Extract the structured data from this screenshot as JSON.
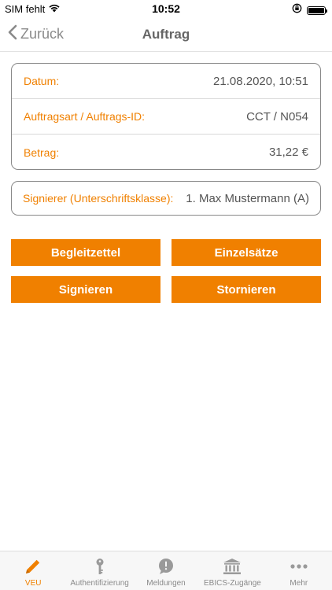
{
  "status_bar": {
    "carrier": "SIM fehlt",
    "time": "10:52"
  },
  "nav": {
    "back_label": "Zurück",
    "title": "Auftrag"
  },
  "details": {
    "rows": [
      {
        "label": "Datum:",
        "value": "21.08.2020, 10:51"
      },
      {
        "label": "Auftragsart / Auftrags-ID:",
        "value": "CCT / N054"
      },
      {
        "label": "Betrag:",
        "value": "31,22 €"
      }
    ]
  },
  "signer": {
    "label": "Signierer (Unterschriftsklasse):",
    "value": "1. Max Mustermann (A)"
  },
  "actions": {
    "begleitzettel": "Begleitzettel",
    "einzelsaetze": "Einzelsätze",
    "signieren": "Signieren",
    "stornieren": "Stornieren"
  },
  "tabs": [
    {
      "label": "VEU",
      "icon": "pencil-icon",
      "active": true
    },
    {
      "label": "Authentifizierung",
      "icon": "key-icon",
      "active": false
    },
    {
      "label": "Meldungen",
      "icon": "alert-bubble-icon",
      "active": false
    },
    {
      "label": "EBICS-Zugänge",
      "icon": "bank-icon",
      "active": false
    },
    {
      "label": "Mehr",
      "icon": "more-icon",
      "active": false
    }
  ],
  "colors": {
    "accent": "#f08000",
    "inactive": "#8a8a8a"
  }
}
